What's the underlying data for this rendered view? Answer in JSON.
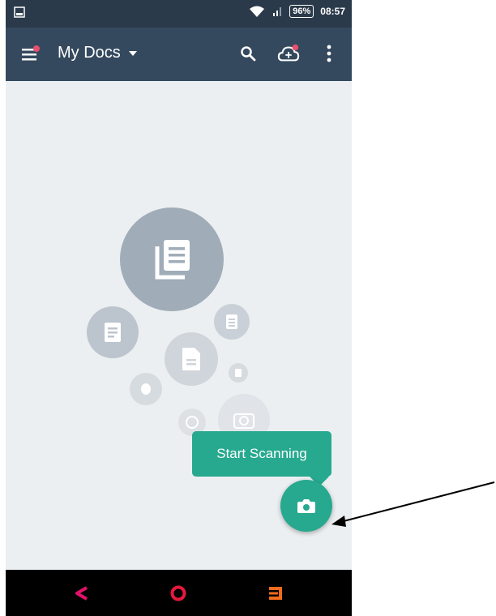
{
  "status_bar": {
    "battery": "96%",
    "time": "08:57"
  },
  "app_bar": {
    "title": "My Docs"
  },
  "icons": {
    "menu": "menu-icon",
    "dropdown": "caret-down-icon",
    "search": "search-icon",
    "cloud": "cloud-add-icon",
    "more": "more-vert-icon",
    "camera": "camera-icon"
  },
  "tooltip": {
    "label": "Start Scanning"
  },
  "colors": {
    "status_bar": "#2b3a4a",
    "app_bar": "#34495e",
    "accent": "#26a98f",
    "background": "#eceff1",
    "notification_dot": "#e94f6e",
    "nav_back": "#e0126a",
    "nav_home": "#e6193c",
    "nav_recent": "#f26b1d"
  }
}
